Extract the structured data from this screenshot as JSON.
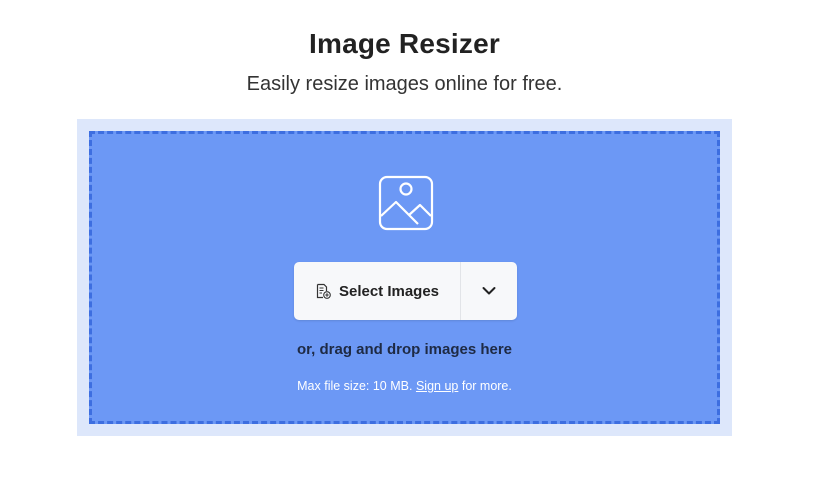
{
  "header": {
    "title": "Image Resizer",
    "subtitle": "Easily resize images online for free."
  },
  "upload": {
    "select_label": "Select Images",
    "select_icon": "file-add-icon",
    "dropdown_icon": "chevron-down-icon",
    "placeholder_icon": "image-icon",
    "drag_text": "or, drag and drop images here",
    "note_prefix": "Max file size: 10 MB.",
    "signup_link": "Sign up",
    "note_suffix": "for more."
  },
  "colors": {
    "dropzone_fill": "#6c98f5",
    "dropzone_border": "#3d6ee0",
    "dropzone_frame": "#dde7fb"
  }
}
